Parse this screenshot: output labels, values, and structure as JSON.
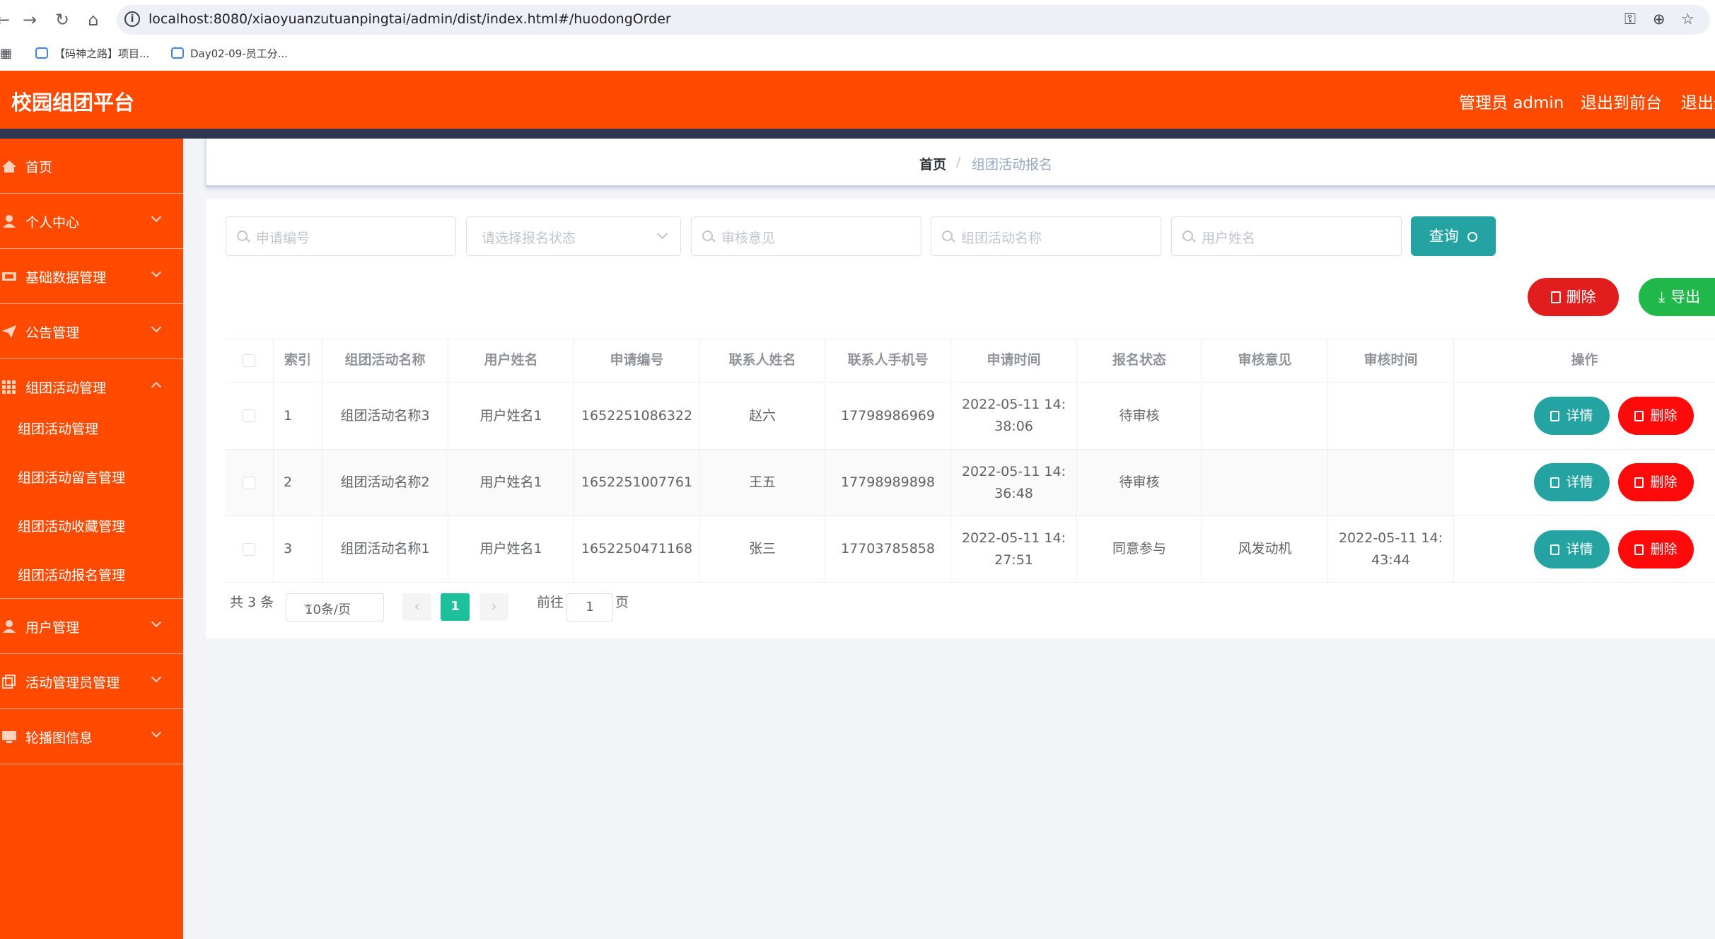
{
  "browser": {
    "url": "localhost:8080/xiaoyuanzutuanpingtai/admin/dist/index.html#/huodongOrder",
    "bookmarks": [
      "【码神之路】项目...",
      "Day02-09-员工分..."
    ]
  },
  "header": {
    "title": "校园组团平台",
    "user_label": "管理员 admin",
    "to_front_label": "退出到前台",
    "logout_label": "退出登"
  },
  "sidebar": {
    "items": [
      {
        "label": "首页",
        "icon": "home-icon",
        "expandable": false
      },
      {
        "label": "个人中心",
        "icon": "user-icon",
        "expandable": true
      },
      {
        "label": "基础数据管理",
        "icon": "data-icon",
        "expandable": true
      },
      {
        "label": "公告管理",
        "icon": "send-icon",
        "expandable": true
      },
      {
        "label": "组团活动管理",
        "icon": "grid-icon",
        "expandable": true,
        "expanded": true
      },
      {
        "label": "用户管理",
        "icon": "user-icon",
        "expandable": true
      },
      {
        "label": "活动管理员管理",
        "icon": "copy-icon",
        "expandable": true
      },
      {
        "label": "轮播图信息",
        "icon": "monitor-icon",
        "expandable": true
      }
    ],
    "sub_items": [
      "组团活动管理",
      "组团活动留言管理",
      "组团活动收藏管理",
      "组团活动报名管理"
    ]
  },
  "breadcrumb": {
    "home": "首页",
    "separator": "/",
    "current": "组团活动报名"
  },
  "search": {
    "apply_no_placeholder": "申请编号",
    "status_placeholder": "请选择报名状态",
    "review_opinion_placeholder": "审核意见",
    "activity_name_placeholder": "组团活动名称",
    "user_name_placeholder": "用户姓名",
    "query_label": "查询"
  },
  "actions": {
    "batch_delete_label": "删除",
    "export_label": "导出"
  },
  "table": {
    "columns": [
      "索引",
      "组团活动名称",
      "用户姓名",
      "申请编号",
      "联系人姓名",
      "联系人手机号",
      "申请时间",
      "报名状态",
      "审核意见",
      "审核时间",
      "操作"
    ],
    "rows": [
      {
        "index": "1",
        "activity": "组团活动名称3",
        "user": "用户姓名1",
        "apply_no": "1652251086322",
        "contact": "赵六",
        "phone": "17798986969",
        "apply_time_1": "2022-05-11 14:",
        "apply_time_2": "38:06",
        "status": "待审核",
        "opinion": "",
        "review_time_1": "",
        "review_time_2": ""
      },
      {
        "index": "2",
        "activity": "组团活动名称2",
        "user": "用户姓名1",
        "apply_no": "1652251007761",
        "contact": "王五",
        "phone": "17798989898",
        "apply_time_1": "2022-05-11 14:",
        "apply_time_2": "36:48",
        "status": "待审核",
        "opinion": "",
        "review_time_1": "",
        "review_time_2": ""
      },
      {
        "index": "3",
        "activity": "组团活动名称1",
        "user": "用户姓名1",
        "apply_no": "1652250471168",
        "contact": "张三",
        "phone": "17703785858",
        "apply_time_1": "2022-05-11 14:",
        "apply_time_2": "27:51",
        "status": "同意参与",
        "opinion": "风发动机",
        "review_time_1": "2022-05-11 14:",
        "review_time_2": "43:44"
      }
    ],
    "detail_label": "详情",
    "delete_label": "删除"
  },
  "pagination": {
    "total_text": "共 3 条",
    "page_size": "10条/页",
    "current_page": "1",
    "goto_prefix": "前往",
    "goto_value": "1",
    "goto_suffix": "页"
  },
  "colors": {
    "primary_orange": "#ff4a00",
    "teal": "#25a3a3",
    "red": "#ff0a0a",
    "green": "#20b84a",
    "pagination_active": "#1cc09b"
  }
}
